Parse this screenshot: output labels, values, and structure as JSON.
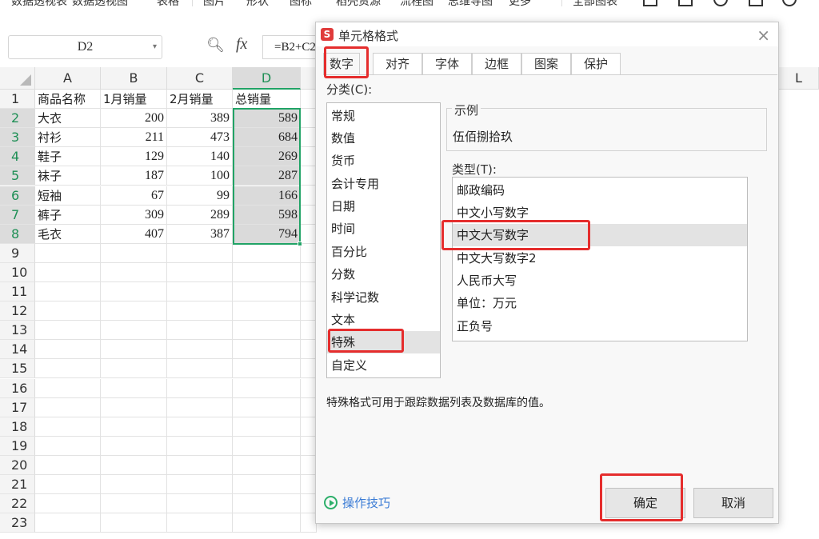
{
  "ribbon": {
    "items": [
      "数据透视表",
      "数据透视图",
      "表格",
      "图片",
      "形状",
      "图标",
      "稻壳资源",
      "流程图",
      "思维导图",
      "更多",
      "全部图表"
    ]
  },
  "formula_bar": {
    "name_box": "D2",
    "fx": "fx",
    "formula": "=B2+C2"
  },
  "sheet": {
    "columns": [
      "A",
      "B",
      "C",
      "D",
      "L"
    ],
    "row_numbers": [
      "1",
      "2",
      "3",
      "4",
      "5",
      "6",
      "7",
      "8",
      "9",
      "10",
      "11",
      "12",
      "13",
      "14",
      "15",
      "16",
      "17",
      "18",
      "19",
      "20",
      "21",
      "22",
      "23"
    ],
    "header_row": [
      "商品名称",
      "1月销量",
      "2月销量",
      "总销量"
    ],
    "rows": [
      [
        "大衣",
        "200",
        "389",
        "589"
      ],
      [
        "衬衫",
        "211",
        "473",
        "684"
      ],
      [
        "鞋子",
        "129",
        "140",
        "269"
      ],
      [
        "袜子",
        "187",
        "100",
        "287"
      ],
      [
        "短袖",
        "67",
        "99",
        "166"
      ],
      [
        "裤子",
        "309",
        "289",
        "598"
      ],
      [
        "毛衣",
        "407",
        "387",
        "794"
      ]
    ]
  },
  "dialog": {
    "title": "单元格格式",
    "close": "×",
    "tabs": [
      "数字",
      "对齐",
      "字体",
      "边框",
      "图案",
      "保护"
    ],
    "active_tab": "数字",
    "category_label": "分类(C):",
    "categories": [
      "常规",
      "数值",
      "货币",
      "会计专用",
      "日期",
      "时间",
      "百分比",
      "分数",
      "科学记数",
      "文本",
      "特殊",
      "自定义"
    ],
    "selected_category": "特殊",
    "sample_label": "示例",
    "sample_value": "伍佰捌拾玖",
    "type_label": "类型(T):",
    "types": [
      "邮政编码",
      "中文小写数字",
      "中文大写数字",
      "中文大写数字2",
      "人民币大写",
      "单位：万元",
      "正负号"
    ],
    "selected_type": "中文大写数字",
    "description": "特殊格式可用于跟踪数据列表及数据库的值。",
    "tips": "操作技巧",
    "ok": "确定",
    "cancel": "取消"
  },
  "colors": {
    "selection_green": "#21a366",
    "annotation_red": "#e52d2d",
    "dialog_logo": "#e03b3b",
    "link_blue": "#3a7bd5"
  }
}
